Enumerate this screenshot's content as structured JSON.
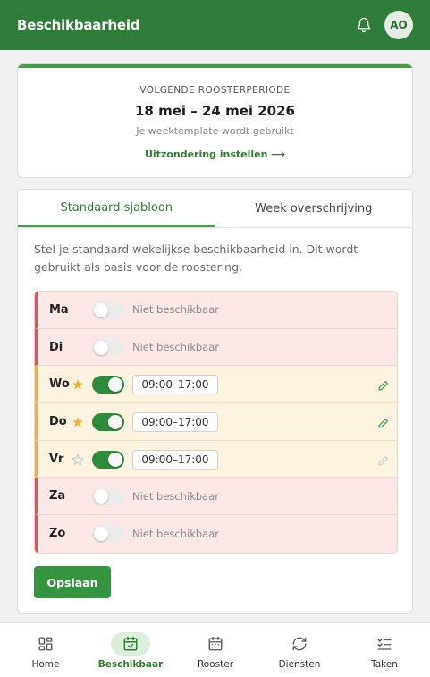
{
  "app": {
    "title": "Beschikbaarheid",
    "avatar_initials": "AO"
  },
  "period_card": {
    "kicker": "VOLGENDE ROOSTERPERIODE",
    "period": "18 mei – 24 mei 2026",
    "subtitle": "Je weektemplate wordt gebruikt",
    "exception_link": "Uitzondering instellen ⟶"
  },
  "tabs": [
    {
      "label": "Standaard sjabloon",
      "active": true
    },
    {
      "label": "Week overschrijving",
      "active": false
    }
  ],
  "description": "Stel je standaard wekelijkse beschikbaarheid in. Dit wordt gebruikt als basis voor de roostering.",
  "days": [
    {
      "label": "Ma",
      "available": false,
      "status": "Niet beschikbaar"
    },
    {
      "label": "Di",
      "available": false,
      "status": "Niet beschikbaar"
    },
    {
      "label": "Wo",
      "available": true,
      "starred": true,
      "time": "09:00–17:00"
    },
    {
      "label": "Do",
      "available": true,
      "starred": true,
      "time": "09:00–17:00"
    },
    {
      "label": "Vr",
      "available": true,
      "starred": false,
      "time": "09:00–17:00"
    },
    {
      "label": "Za",
      "available": false,
      "status": "Niet beschikbaar"
    },
    {
      "label": "Zo",
      "available": false,
      "status": "Niet beschikbaar"
    }
  ],
  "save_label": "Opslaan",
  "nav": [
    {
      "label": "Home",
      "icon": "grid-icon",
      "active": false
    },
    {
      "label": "Beschikbaar",
      "icon": "calendar-check-icon",
      "active": true
    },
    {
      "label": "Rooster",
      "icon": "calendar-icon",
      "active": false
    },
    {
      "label": "Diensten",
      "icon": "refresh-icon",
      "active": false
    },
    {
      "label": "Taken",
      "icon": "checklist-icon",
      "active": false
    }
  ],
  "colors": {
    "primary": "#2e7d3a",
    "unavailable_bg": "#fde8e8",
    "unavailable_accent": "#e35555",
    "available_bg": "#fdf3e1",
    "available_accent": "#f2b13c",
    "star": "#f2b13c"
  }
}
